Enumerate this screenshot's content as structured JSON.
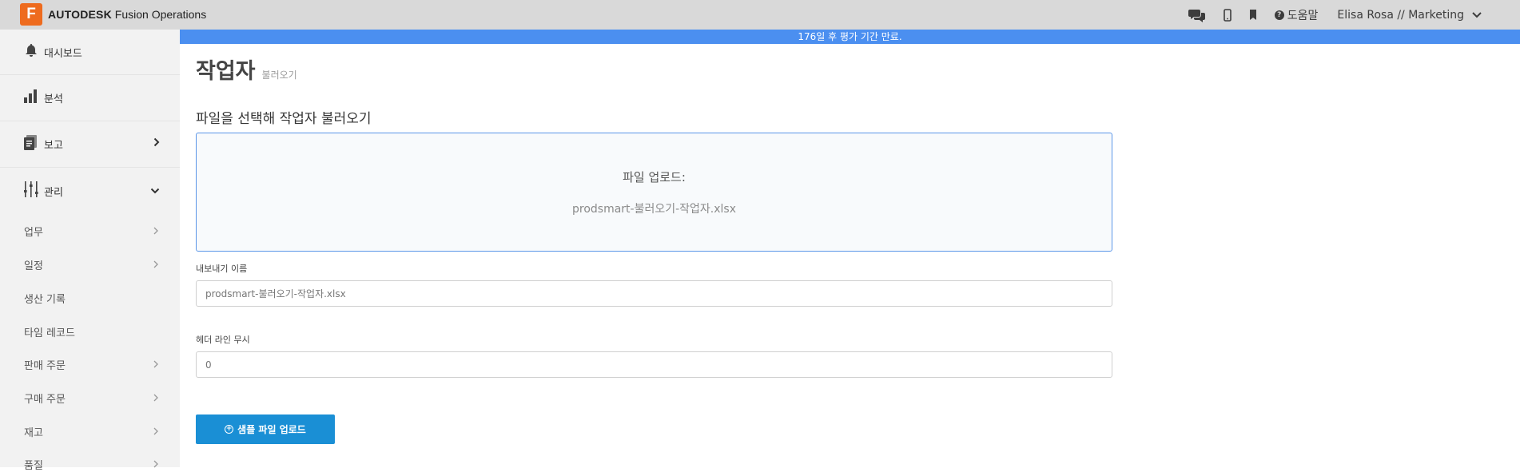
{
  "app": {
    "logo_letter": "F",
    "brand_bold": "AUTODESK",
    "brand_rest": "Fusion Operations"
  },
  "topbar": {
    "icons": [
      "chat-icon",
      "mobile-icon",
      "bookmark-icon"
    ],
    "help_label": "도움말",
    "user_label": "Elisa Rosa // Marketing"
  },
  "banner": {
    "text": "176일 후 평가 기간 만료."
  },
  "sidebar": {
    "items": [
      {
        "label": "대시보드",
        "icon": "bell-icon"
      },
      {
        "label": "분석",
        "icon": "bar-chart-icon"
      },
      {
        "label": "보고",
        "icon": "report-icon"
      },
      {
        "label": "관리",
        "icon": "sliders-icon"
      }
    ],
    "sub_items": [
      {
        "label": "업무"
      },
      {
        "label": "일정"
      },
      {
        "label": "생산 기록"
      },
      {
        "label": "타임 레코드"
      },
      {
        "label": "판매 주문"
      },
      {
        "label": "구매 주문"
      },
      {
        "label": "재고"
      },
      {
        "label": "품질"
      }
    ]
  },
  "main": {
    "title": "작업자",
    "subtitle": "불러오기",
    "section_heading": "파일을 선택해 작업자 불러오기",
    "dropzone": {
      "title": "파일 업로드:",
      "filename": "prodsmart-불러오기-작업자.xlsx"
    },
    "export_name": {
      "label": "내보내기 이름",
      "value": "prodsmart-불러오기-작업자.xlsx"
    },
    "ignore_header": {
      "label": "헤더 라인 무시",
      "value": "0"
    },
    "upload_button": "샘플 파일 업로드"
  },
  "colors": {
    "accent_blue": "#1a8fd5",
    "banner_blue": "#4b8ff0",
    "logo_orange": "#ee6b1e"
  }
}
